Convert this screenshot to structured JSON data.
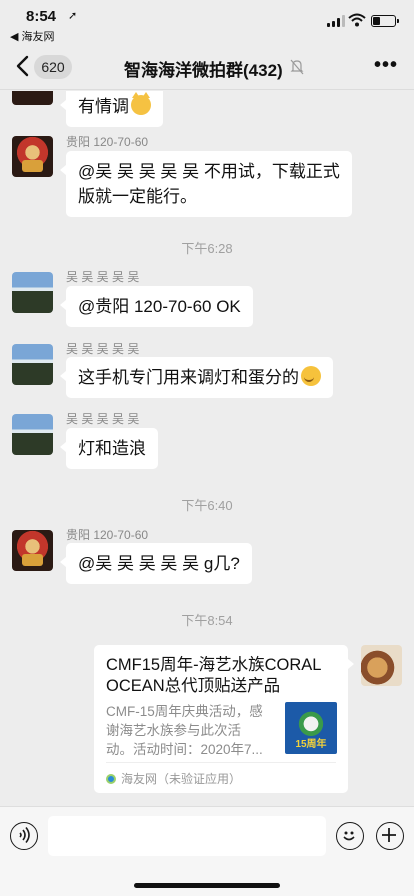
{
  "status_bar": {
    "time": "8:54",
    "back_app": "◀ 海友网"
  },
  "nav": {
    "unread_count": "620",
    "title": "智海海洋微拍群(432)"
  },
  "messages": [
    {
      "type": "text",
      "sender": "",
      "text": "有情调",
      "emoji": "cat-face"
    },
    {
      "type": "text",
      "sender": "贵阳  120-70-60",
      "text_lines": [
        "@吴 吴 吴 吴 吴 不用试，下载正式",
        "版就一定能行。"
      ]
    },
    {
      "type": "time",
      "text": "下午6:28"
    },
    {
      "type": "text",
      "sender": "吴 吴 吴 吴 吴",
      "text": "@贵阳  120-70-60 OK"
    },
    {
      "type": "text",
      "sender": "吴 吴 吴 吴 吴",
      "text": "这手机专门用来调灯和蛋分的",
      "emoji": "sweat-smile"
    },
    {
      "type": "text",
      "sender": "吴 吴 吴 吴 吴",
      "text": "灯和造浪"
    },
    {
      "type": "time",
      "text": "下午6:40"
    },
    {
      "type": "text",
      "sender": "贵阳  120-70-60",
      "text": "@吴 吴 吴 吴 吴 g几?"
    },
    {
      "type": "time",
      "text": "下午8:54"
    }
  ],
  "link_card": {
    "title_lines": [
      "CMF15周年-海艺水族CORAL",
      "OCEAN总代顶贴送产品"
    ],
    "desc_lines": [
      "CMF-15周年庆典活动，感",
      "谢海艺水族参与此次活",
      "动。活动时间：2020年7..."
    ],
    "thumb_text": "15周年",
    "source": "海友网（未验证应用）"
  },
  "colors": {
    "background": "#ededed",
    "bubble": "#ffffff",
    "meta_text": "#888888"
  }
}
